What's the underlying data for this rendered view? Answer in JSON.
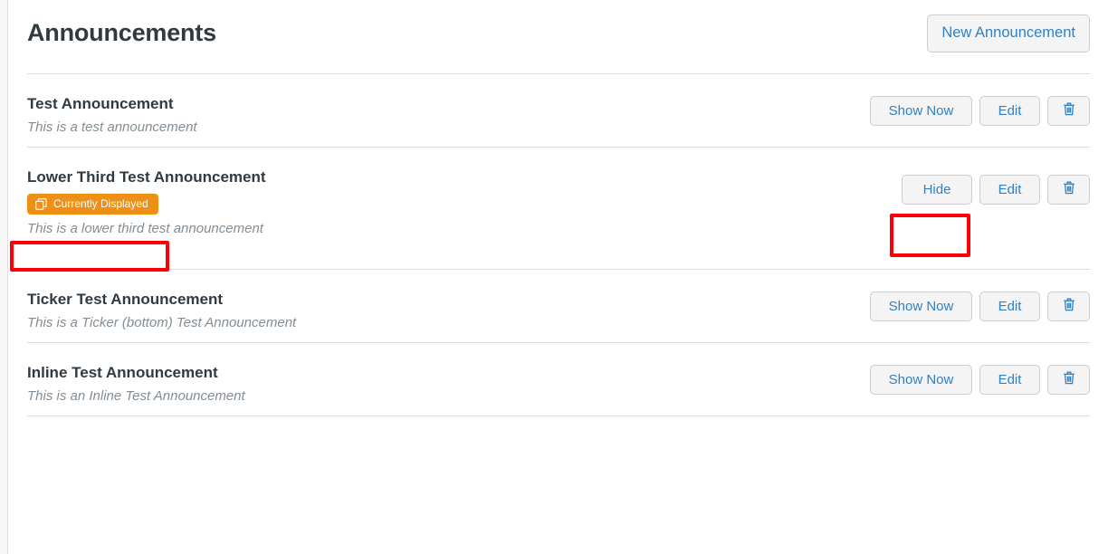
{
  "header": {
    "title": "Announcements",
    "new_button_label": "New Announcement"
  },
  "labels": {
    "show_now": "Show Now",
    "hide": "Hide",
    "edit": "Edit",
    "delete_icon": "trash-icon",
    "badge_icon": "clone-icon"
  },
  "colors": {
    "accent_blue": "#3082c4",
    "badge_orange": "#ef9016",
    "annotation_red": "#fb0007",
    "title_dark": "#2f3a41",
    "desc_gray": "#838d95",
    "button_bg": "#f4f4f4",
    "button_border": "#cccccc",
    "divider": "#dcdcdc"
  },
  "announcements": [
    {
      "title": "Test Announcement",
      "description": "This is a test announcement",
      "toggle_label": "Show Now",
      "edit_label": "Edit",
      "badge": null,
      "highlighted": false
    },
    {
      "title": "Lower Third Test Announcement",
      "description": "This is a lower third test announcement",
      "toggle_label": "Hide",
      "edit_label": "Edit",
      "badge": "Currently Displayed",
      "highlighted": true
    },
    {
      "title": "Ticker Test Announcement",
      "description": "This is a Ticker (bottom) Test Announcement",
      "toggle_label": "Show Now",
      "edit_label": "Edit",
      "badge": null,
      "highlighted": false
    },
    {
      "title": "Inline Test Announcement",
      "description": "This is an Inline Test Announcement",
      "toggle_label": "Show Now",
      "edit_label": "Edit",
      "badge": null,
      "highlighted": false
    }
  ]
}
